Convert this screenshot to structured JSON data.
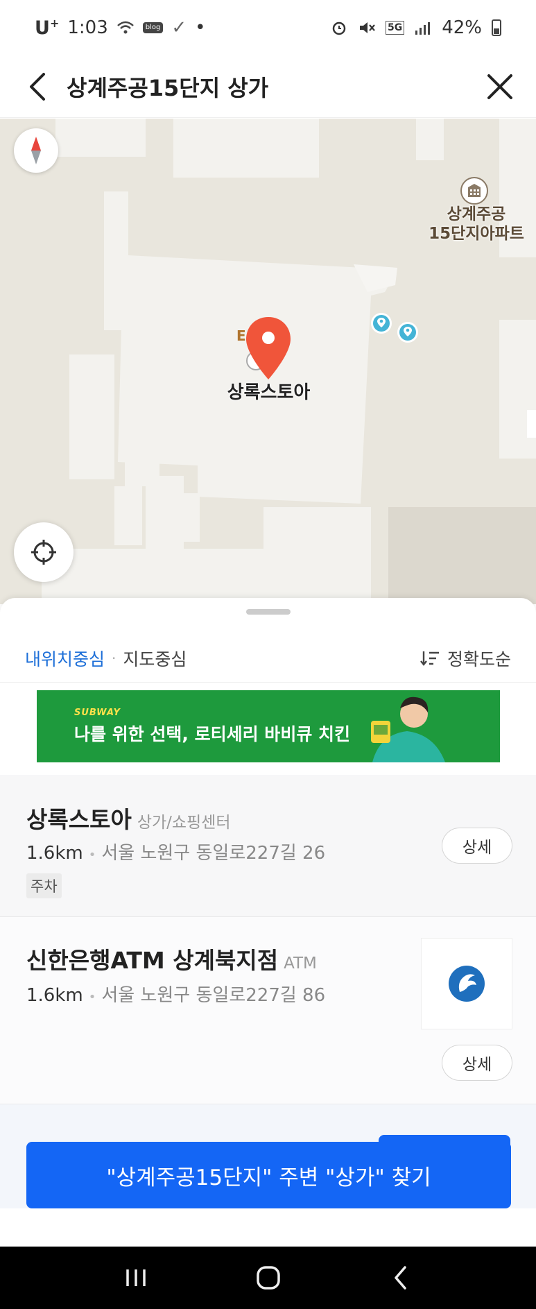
{
  "status_bar": {
    "carrier": "U",
    "carrier_sup": "+",
    "time": "1:03",
    "blog_badge": "blog",
    "check": "✓",
    "dot": "•",
    "network": "5G",
    "battery": "42%"
  },
  "header": {
    "title": "상계주공15단지 상가"
  },
  "map": {
    "apt_label_line1": "상계주공",
    "apt_label_line2": "15단지아파트",
    "selected_label": "상록스토아",
    "hidden_letter": "E"
  },
  "filters": {
    "active": "내위치중심",
    "separator": "·",
    "inactive": "지도중심",
    "sort": "정확도순"
  },
  "ad": {
    "brand": "SUBWAY",
    "copy": "나를 위한 선택, 로티세리 바비큐 치킨"
  },
  "results": [
    {
      "name": "상록스토아",
      "category": "상가/쇼핑센터",
      "distance": "1.6km",
      "address": "서울 노원구 동일로227길 26",
      "tag": "주차",
      "detail": "상세"
    },
    {
      "name": "신한은행ATM 상계북지점",
      "category": "ATM",
      "distance": "1.6km",
      "address": "서울 노원구 동일로227길 86",
      "detail": "상세"
    }
  ],
  "cta": {
    "label": "\"상계주공15단지\" 주변 \"상가\" 찾기"
  },
  "colors": {
    "accent_blue": "#1466f5",
    "link_blue": "#1d6fd8",
    "pin_red": "#f0553a",
    "ad_green": "#1e9a3d"
  }
}
